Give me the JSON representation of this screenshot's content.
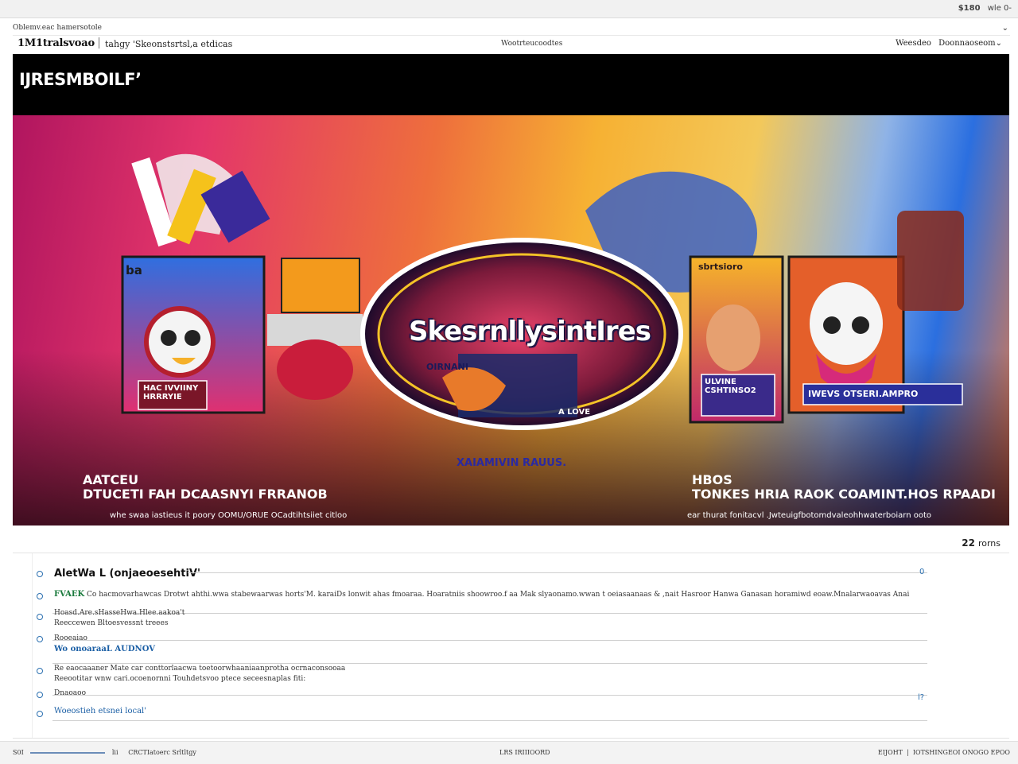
{
  "topbar": {
    "right_num": "$180",
    "right_text": "wle 0-"
  },
  "meta": {
    "line": "Oblemv.eac hamersotole",
    "caret": "⌄"
  },
  "nav": {
    "brand": "1M1tralsvoao",
    "link": "tahgy 'Skeonstsrtsl,a etdicas",
    "center": "Wootrteucoodtes",
    "right_1": "Weesdeo",
    "right_2": "Doonnaoseom⌄"
  },
  "banner": {
    "title": "IJRESMBOILFʼ"
  },
  "hero": {
    "logo_text": "SkesrnllysintIres",
    "mid_text": "XAIAMIVIN RAUUS.",
    "left_title_1": "AATCEU",
    "left_title_2": "DTUCETI FAH  DCAASNYI FRRANOB",
    "left_caption": "whe swaa iastieus it poory  OOMU/ORUE OCadtihtsiiet citloo",
    "right_title_1": "HBOS",
    "right_title_2": "TONKES HRIA RAOK COAMINT.HOS RPAADI",
    "right_caption": "ear thurat fonitacvl .Jwteuigfbotomdvaleohhwaterboiarn ooto",
    "card_left_top": "ba",
    "card_left_tag": "HAC IVVIINY HRRRYIE",
    "card_right_top": "sbrtsioro",
    "card_right_tag": "ULVINE CSHTINSO2",
    "card_far_right": "IWEVS OTSERI.AMPRO",
    "center_badge": "OIRNANI",
    "center_tag": "A LOVE"
  },
  "count": {
    "num": "22",
    "label": "rorns"
  },
  "list": [
    {
      "title": "AletWa L (onjaeoesehtiV'",
      "text": "",
      "end": "0"
    },
    {
      "tag": "FVAEK",
      "text": "Co hacmovarhawcas Drotwt ahthi.wwa stabewaarwas horts'M. karaiDs lonwit ahas fmoaraa. Hoaratniis shoowroo.f aa Mak slyaonamo.wwan t oeiasaanaas & ,nait Hasroor Hanwa Ganasan horamiwd eoaw.Mnalarwaoavas Anai",
      "end": ""
    },
    {
      "text": "Hoasd.Are.sHasseHwa.Hlee.aakoa't",
      "text2": "Reeccewen Bltoesvessnt treees",
      "end": ""
    },
    {
      "text": "Rooeaiao",
      "link": "Wo onoaraaL AUDNOV",
      "end": ""
    },
    {
      "text": "Re eaocaaaner Mate car conttorlaacwa toetoorwhaaniaanprotha ocrnaconsooaa",
      "text2": "Reeootitar wnw cari.ocoenornni Touhdetsvoo ptece seceesnaplas fiti:",
      "end": ""
    },
    {
      "text": "Dnaoaoo",
      "end": "l?"
    },
    {
      "link": "Woeostieh etsnei local'",
      "end": ""
    }
  ],
  "footer": {
    "left_1": "S0I",
    "left_2": "lii",
    "left_3": "CRCTIatoerc Srltltgy",
    "mid": "LRS IRIIIOORD",
    "right_1": "EIJOHT",
    "right_2": "IOTSHINGEOI ONOGO EPOO"
  },
  "colors": {
    "banner": "#000000",
    "accent_link": "#1b5fa5",
    "bullet": "#2a6fb0",
    "tag_green": "#1c7b3e"
  }
}
